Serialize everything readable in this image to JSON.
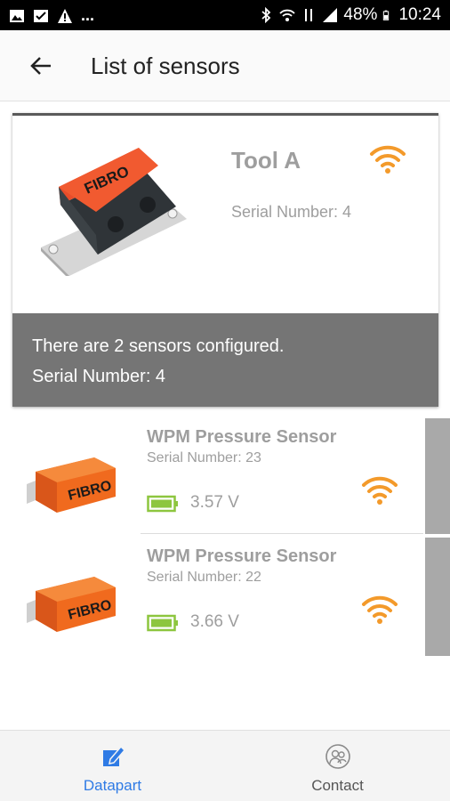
{
  "status_bar": {
    "left_overflow": "...",
    "battery_percent": "48%",
    "time": "10:24"
  },
  "app_bar": {
    "title": "List of sensors",
    "back_icon": "arrow-left-icon"
  },
  "tool_card": {
    "name": "Tool A",
    "serial": "Serial Number: 4",
    "brand": "FIBRO",
    "info_line1": "There are 2 sensors configured.",
    "info_line2": "Serial Number: 4",
    "signal_icon": "wifi-icon"
  },
  "sensors": [
    {
      "name": "WPM Pressure Sensor",
      "serial": "Serial Number: 23",
      "voltage": "3.57 V",
      "brand": "FIBRO",
      "battery_icon": "battery-icon",
      "signal_icon": "wifi-icon"
    },
    {
      "name": "WPM Pressure Sensor",
      "serial": "Serial Number: 22",
      "voltage": "3.66 V",
      "brand": "FIBRO",
      "battery_icon": "battery-icon",
      "signal_icon": "wifi-icon"
    }
  ],
  "bottom_nav": {
    "items": [
      {
        "label": "Datapart",
        "icon": "edit-icon",
        "active": true
      },
      {
        "label": "Contact",
        "icon": "contact-icon",
        "active": false
      }
    ]
  },
  "colors": {
    "accent_orange": "#f39a2b",
    "battery_green": "#8dc63f",
    "nav_active_blue": "#2f7be5",
    "info_bar_gray": "#757575",
    "muted_text": "#9e9e9e"
  }
}
